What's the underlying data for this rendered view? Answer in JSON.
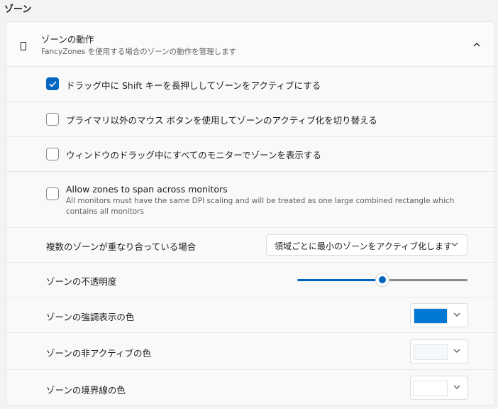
{
  "section_title": "ゾーン",
  "header": {
    "title": "ゾーンの動作",
    "description": "FancyZones を使用する場合のゾーンの動作を管理します",
    "icon": "phone-icon",
    "collapse_icon": "chevron-up-icon"
  },
  "checkboxes": [
    {
      "label": "ドラッグ中に Shift キーを長押ししてゾーンをアクティブにする",
      "checked": true
    },
    {
      "label": "プライマリ以外のマウス ボタンを使用してゾーンのアクティブ化を切り替える",
      "checked": false
    },
    {
      "label": "ウィンドウのドラッグ中にすべてのモニターでゾーンを表示する",
      "checked": false
    },
    {
      "label": "Allow zones to span across monitors",
      "description": "All monitors must have the same DPI scaling and will be treated as one large combined rectangle which contains all monitors",
      "checked": false
    }
  ],
  "overlap": {
    "label": "複数のゾーンが重なり合っている場合",
    "selected": "領域ごとに最小のゾーンをアクティブ化します"
  },
  "opacity": {
    "label": "ゾーンの不透明度",
    "value_fraction": 0.5
  },
  "colors": {
    "highlight": {
      "label": "ゾーンの強調表示の色",
      "value": "#0078d4"
    },
    "inactive": {
      "label": "ゾーンの非アクティブの色",
      "value": "#f3f9fd"
    },
    "border": {
      "label": "ゾーンの境界線の色",
      "value": "#ffffff"
    }
  },
  "accent_color": "#0067c0"
}
